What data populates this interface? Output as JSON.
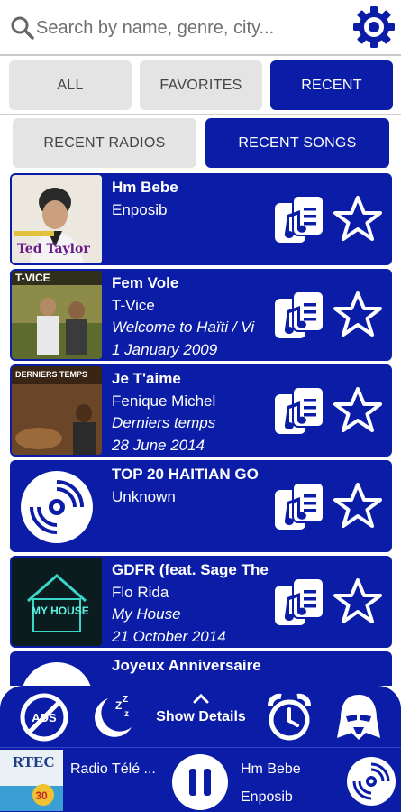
{
  "search": {
    "placeholder": "Search by name, genre, city..."
  },
  "main_tabs": [
    {
      "label": "ALL",
      "active": false
    },
    {
      "label": "FAVORITES",
      "active": false
    },
    {
      "label": "RECENT",
      "active": true
    }
  ],
  "sub_tabs": [
    {
      "label": "RECENT RADIOS",
      "active": false
    },
    {
      "label": "RECENT SONGS",
      "active": true
    }
  ],
  "songs": [
    {
      "title": "Hm Bebe",
      "artist": "Enposib",
      "album": "",
      "date": "",
      "cover_text": "Ted Taylor"
    },
    {
      "title": "Fem Vole",
      "artist": "T-Vice",
      "album": "Welcome to Haïti / Vi",
      "date": "1 January 2009",
      "cover_text": "T-VICE"
    },
    {
      "title": "Je T'aime",
      "artist": "Fenique Michel",
      "album": "Derniers temps",
      "date": "28 June 2014",
      "cover_text": "DERNIERS TEMPS"
    },
    {
      "title": "TOP 20 HAITIAN GO",
      "artist": "Unknown",
      "album": "",
      "date": "",
      "cover_text": ""
    },
    {
      "title": "GDFR (feat. Sage The",
      "artist": "Flo Rida",
      "album": "My House",
      "date": "21 October 2014",
      "cover_text": "MY HOUSE"
    },
    {
      "title": "Joyeux Anniversaire",
      "artist": "",
      "album": "",
      "date": "",
      "cover_text": ""
    }
  ],
  "toolbar": {
    "show_details_label": "Show Details",
    "icons": [
      "no-ads-icon",
      "sleep-timer-icon",
      "chevron-up-icon",
      "alarm-clock-icon",
      "darth-vader-icon"
    ]
  },
  "player": {
    "station_name": "Radio Télé ...",
    "station_logo_text": "RTEC",
    "now_playing_title": "Hm Bebe",
    "now_playing_artist": "Enposib"
  },
  "colors": {
    "primary": "#0b1da6",
    "tab_inactive": "#e4e4e4",
    "text_inactive": "#444444"
  }
}
